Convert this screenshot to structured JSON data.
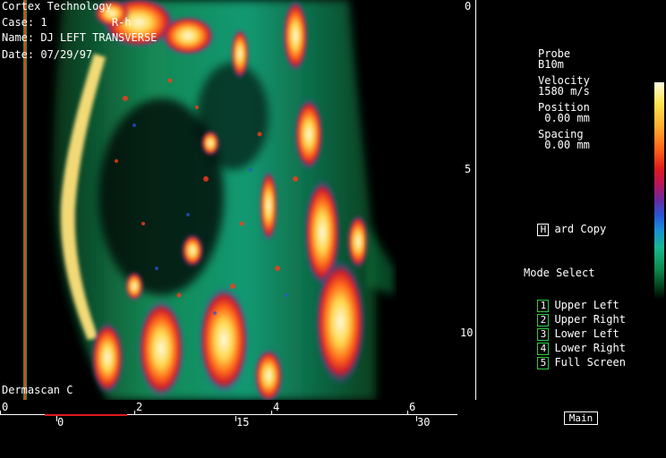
{
  "header": {
    "company": "Cortex Technology",
    "case": "Case: 1          R-h",
    "name": "Name: DJ LEFT TRANSVERSE",
    "date": "Date: 07/29/97"
  },
  "footer_label": "Dermascan C",
  "params": {
    "probe_label": "Probe",
    "probe_value": "B10m",
    "velocity_label": "Velocity",
    "velocity_value": "1580 m/s",
    "position_label": "Position",
    "position_value": " 0.00 mm",
    "spacing_label": "Spacing",
    "spacing_value": " 0.00 mm"
  },
  "hard_copy": {
    "key": "H",
    "label": "ard Copy"
  },
  "mode_select": {
    "title": "Mode Select",
    "items": [
      {
        "key": "1",
        "label": "Upper Left"
      },
      {
        "key": "2",
        "label": "Upper Right"
      },
      {
        "key": "3",
        "label": "Lower Left"
      },
      {
        "key": "4",
        "label": "Lower Right"
      },
      {
        "key": "5",
        "label": "Full Screen"
      }
    ]
  },
  "depth_scale": [
    "0",
    "5",
    "10"
  ],
  "lateral_scale_top": [
    "0",
    "2",
    "4",
    "6"
  ],
  "lateral_scale_bottom": [
    "0",
    "15",
    "30"
  ],
  "main_button": "Main",
  "colors": {
    "background": "#000000",
    "mode_box": "#2ecc40",
    "scale_red": "#e0191e"
  }
}
